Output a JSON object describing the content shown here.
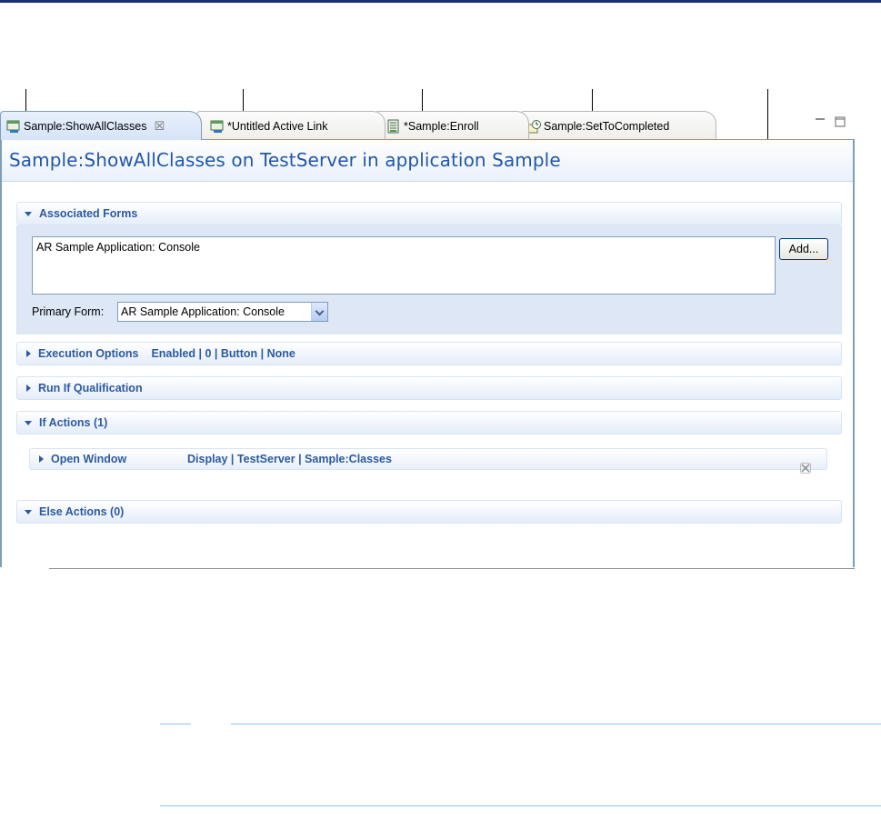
{
  "tabs": [
    {
      "label": "Sample:ShowAllClasses",
      "icon": "active-link-icon",
      "active": true,
      "close": "☒"
    },
    {
      "label": "*Untitled Active Link",
      "icon": "active-link-icon"
    },
    {
      "label": "*Sample:Enroll",
      "icon": "form-icon"
    },
    {
      "label": "Sample:SetToCompleted",
      "icon": "escalation-icon"
    }
  ],
  "editor": {
    "title": "Sample:ShowAllClasses on TestServer in application Sample"
  },
  "associated_forms": {
    "header": "Associated Forms",
    "list": [
      "AR Sample Application: Console"
    ],
    "add_label": "Add...",
    "primary_label": "Primary Form:",
    "primary_value": "AR Sample Application: Console"
  },
  "execution_options": {
    "header": "Execution Options",
    "detail": "Enabled | 0 | Button |  None"
  },
  "run_if": {
    "header": "Run If Qualification"
  },
  "if_actions": {
    "header": "If Actions (1)",
    "items": [
      {
        "name": "Open Window",
        "detail": "Display | TestServer | Sample:Classes"
      }
    ]
  },
  "else_actions": {
    "header": "Else Actions (0)"
  },
  "colors": {
    "accent": "#2c5aa0",
    "title": "#2357a8",
    "border": "#7f9db9",
    "section_fill": "#dde7f6",
    "note_rule": "#8fc3ea"
  }
}
